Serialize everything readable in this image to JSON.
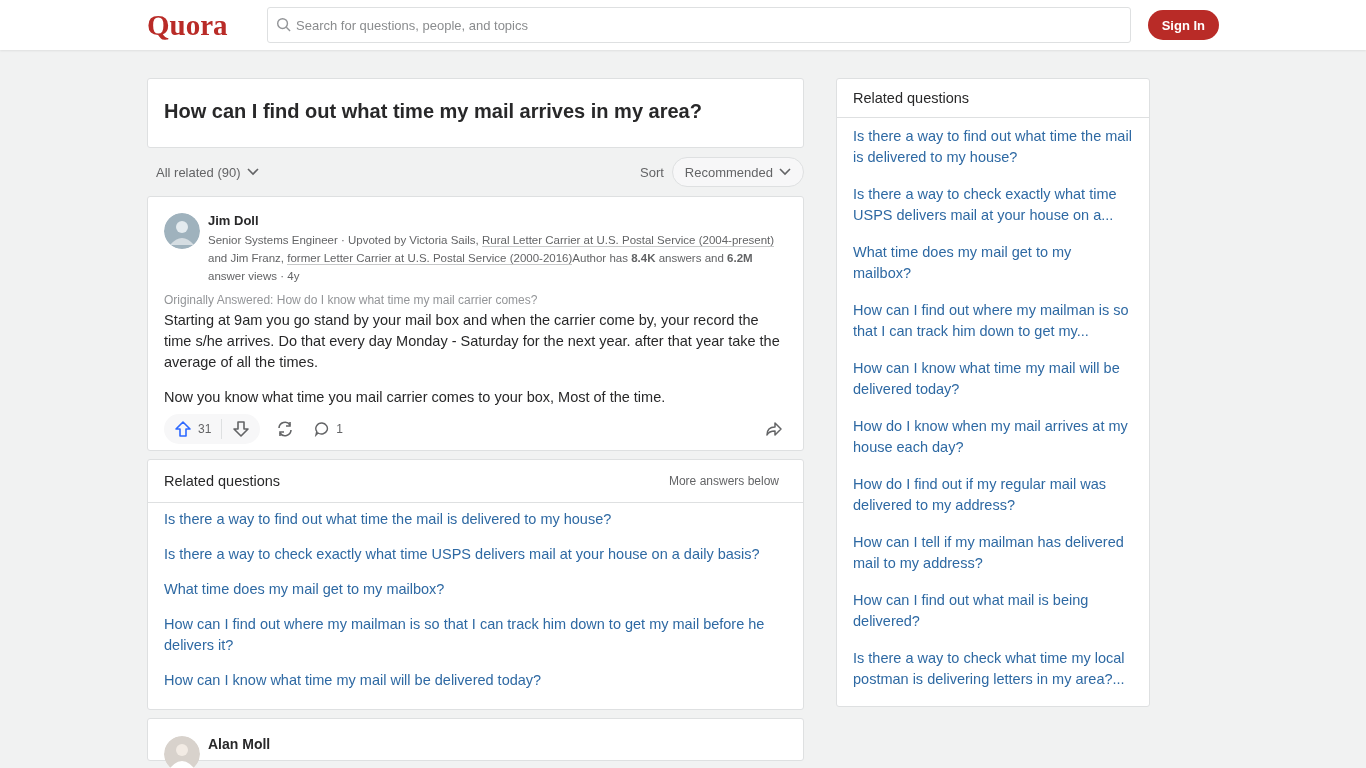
{
  "header": {
    "logo": "Quora",
    "search": {
      "placeholder": "Search for questions, people, and topics"
    },
    "sign_in": "Sign In"
  },
  "question": {
    "title": "How can I find out what time my mail arrives in my area?"
  },
  "filter": {
    "all_related": "All related (90)",
    "sort_label": "Sort",
    "sort_value": "Recommended"
  },
  "answer": {
    "author": "Jim Doll",
    "meta": [
      {
        "kind": "text",
        "text": "Senior Systems Engineer · Upvoted by Victoria Sails, "
      },
      {
        "kind": "link",
        "text": "Rural Letter Carrier at U.S. Postal Service (2004-present)"
      },
      {
        "kind": "text",
        "text": " and Jim Franz, "
      },
      {
        "kind": "link",
        "text": "former Letter Carrier at U.S. Postal Service (2000-2016)"
      },
      {
        "kind": "text",
        "text": "Author has **8.4K** answers and **6.2M** answer views · 4y"
      }
    ],
    "originally_answered": "Originally Answered: How do I know what time my mail carrier comes?",
    "paragraphs": [
      "Starting at 9am you go stand by your mail box and when the carrier come by, your record the time s/he arrives. Do that every day Monday - Saturday for the next year. after that year take the average of all the times.",
      "Now you know what time you mail carrier comes to your box, Most of the time."
    ],
    "upvotes": "31",
    "comments": "1"
  },
  "related_inline": {
    "title": "Related questions",
    "more": "More answers below",
    "items": [
      "Is there a way to find out what time the mail is delivered to my house?",
      "Is there a way to check exactly what time USPS delivers mail at your house on a daily basis?",
      "What time does my mail get to my mailbox?",
      "How can I find out where my mailman is so that I can track him down to get my mail before he delivers it?",
      "How can I know what time my mail will be delivered today?"
    ]
  },
  "next_answer": {
    "author": "Alan Moll"
  },
  "sidebar": {
    "title": "Related questions",
    "items": [
      "Is there a way to find out what time the mail is delivered to my house?",
      "Is there a way to check exactly what time USPS delivers mail at your house on a...",
      "What time does my mail get to my mailbox?",
      "How can I find out where my mailman is so that I can track him down to get my...",
      "How can I know what time my mail will be delivered today?",
      "How do I know when my mail arrives at my house each day?",
      "How do I find out if my regular mail was delivered to my address?",
      "How can I tell if my mailman has delivered mail to my address?",
      "How can I find out what mail is being delivered?",
      "Is there a way to check what time my local postman is delivering letters in my area?..."
    ]
  }
}
